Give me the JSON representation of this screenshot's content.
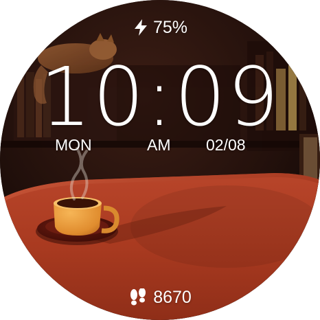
{
  "status": {
    "battery_level": "75%",
    "battery_icon": "charging-bolt-icon"
  },
  "clock": {
    "time": "10:09",
    "day": "MON",
    "period": "AM",
    "date": "02/08"
  },
  "activity": {
    "steps": "8670",
    "steps_icon": "footprints-icon"
  },
  "colors": {
    "text": "#ffffff",
    "table": "#b03e22",
    "background": "#1a0d0a",
    "cup": "#e39a3a"
  }
}
